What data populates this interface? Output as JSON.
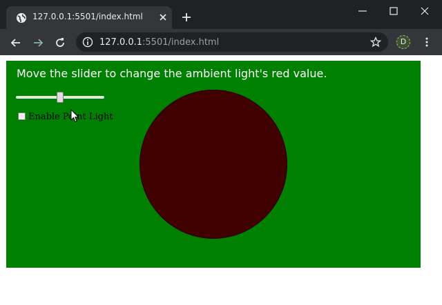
{
  "browser": {
    "tab_title": "127.0.0.1:5501/index.html",
    "url_host": "127.0.0.1",
    "url_rest": ":5501/index.html",
    "profile_initial": "D",
    "icons": {
      "favicon": "globe-icon",
      "tab_close": "close-icon",
      "new_tab": "plus-icon",
      "minimize": "minimize-icon",
      "maximize": "maximize-icon",
      "close_window": "close-icon",
      "back": "back-arrow-icon",
      "forward": "forward-arrow-icon",
      "reload": "reload-icon",
      "site_info": "info-icon",
      "bookmark": "star-icon",
      "menu": "more-vert-icon"
    }
  },
  "page": {
    "caption": "Move the slider to change the ambient light's red value.",
    "slider": {
      "value_fraction": 0.5
    },
    "checkbox": {
      "label": "Enable Point Light",
      "checked": false
    },
    "colors": {
      "background": "#008000",
      "sphere": "#400000",
      "caption_text": "#ffffff"
    }
  }
}
